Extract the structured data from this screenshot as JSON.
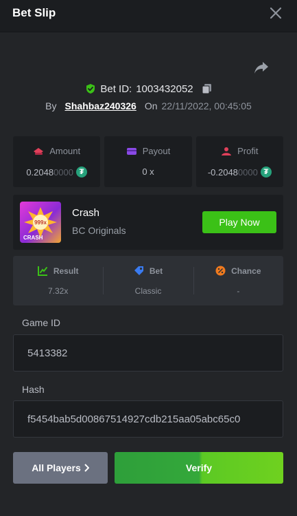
{
  "header": {
    "title": "Bet Slip"
  },
  "bet": {
    "id_label": "Bet ID:",
    "id_value": "1003432052",
    "by_label": "By",
    "username": "Shahbaz240326",
    "on_label": "On",
    "datetime": "22/11/2022, 00:45:05"
  },
  "stats": {
    "amount": {
      "label": "Amount",
      "value": "0.2048",
      "value_dim": "0000",
      "currency_icon": "tether-icon"
    },
    "payout": {
      "label": "Payout",
      "value": "0 x"
    },
    "profit": {
      "label": "Profit",
      "value": "-0.2048",
      "value_dim": "0000",
      "currency_icon": "tether-icon"
    }
  },
  "game": {
    "name": "Crash",
    "provider": "BC Originals",
    "play_label": "Play Now",
    "thumb_multiplier": "999x",
    "thumb_title": "CRASH"
  },
  "results": {
    "result": {
      "label": "Result",
      "value": "7.32x"
    },
    "bet": {
      "label": "Bet",
      "value": "Classic"
    },
    "chance": {
      "label": "Chance",
      "value": "-"
    }
  },
  "fields": {
    "game_id": {
      "label": "Game ID",
      "value": "5413382"
    },
    "hash": {
      "label": "Hash",
      "value": "f5454bab5d00867514927cdb215aa05abc65c0"
    }
  },
  "buttons": {
    "all_players": "All Players",
    "verify": "Verify"
  },
  "colors": {
    "accent_green": "#3bc117",
    "tether": "#26a17b",
    "background": "#232528",
    "card": "#1b1d20"
  }
}
